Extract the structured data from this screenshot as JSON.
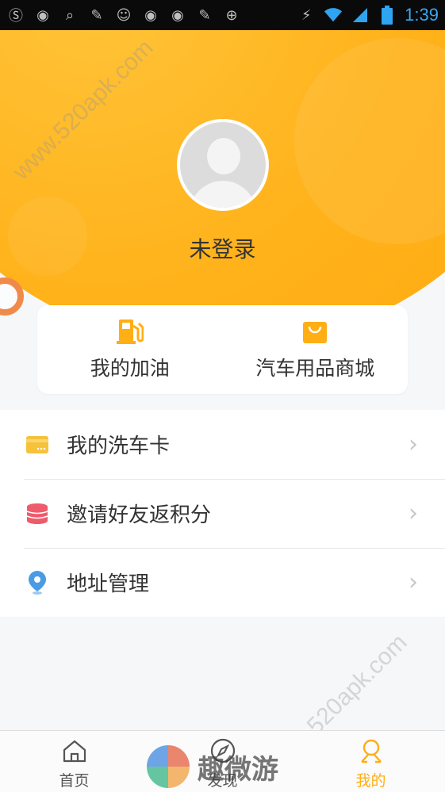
{
  "status_bar": {
    "time": "1:39",
    "left_icons": [
      "sogou-icon",
      "colorful-ball-icon",
      "search-icon",
      "tool-icon",
      "glasses-icon",
      "colorful-ball-icon",
      "colorful-ball-icon",
      "tool-icon",
      "locate-icon"
    ],
    "right_icons": [
      "no-signal-icon",
      "wifi-icon",
      "cellular-icon",
      "battery-icon"
    ]
  },
  "profile": {
    "login_status": "未登录"
  },
  "quick_actions": [
    {
      "label": "我的加油",
      "icon": "fuel-pump-icon"
    },
    {
      "label": "汽车用品商城",
      "icon": "shopping-bag-icon"
    }
  ],
  "menu": [
    {
      "label": "我的洗车卡",
      "icon": "card-icon"
    },
    {
      "label": "邀请好友返积分",
      "icon": "coins-stack-icon"
    },
    {
      "label": "地址管理",
      "icon": "location-pin-icon"
    }
  ],
  "bottom_nav": [
    {
      "label": "首页",
      "icon": "home-icon",
      "active": false
    },
    {
      "label": "发现",
      "icon": "compass-icon",
      "active": false
    },
    {
      "label": "我的",
      "icon": "user-icon",
      "active": true
    }
  ],
  "watermark": {
    "url": "www.520apk.com",
    "logo_text": "趣微游"
  },
  "colors": {
    "accent": "#ffae14",
    "card_icon": "#f5c23a",
    "coins_icon": "#ee5b6b",
    "pin_icon": "#4a9be6"
  }
}
